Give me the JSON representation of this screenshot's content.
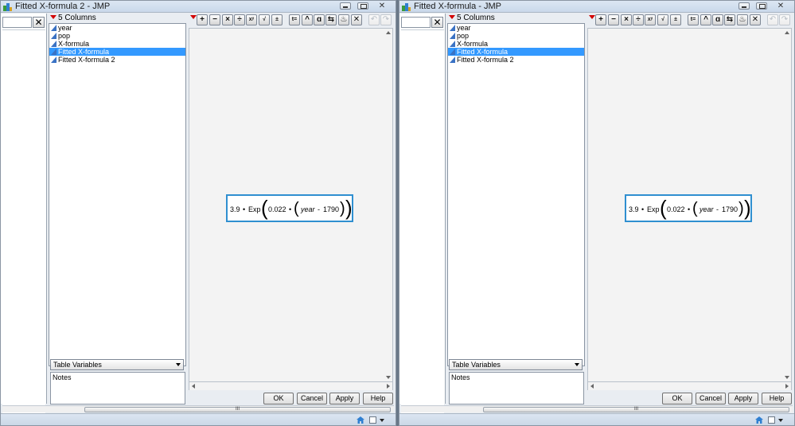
{
  "windows": [
    {
      "title": "Fitted X-formula 2 - JMP",
      "column_count_label": "5 Columns",
      "columns": [
        {
          "label": "year",
          "selected": false
        },
        {
          "label": "pop",
          "selected": false
        },
        {
          "label": "X-formula",
          "selected": false
        },
        {
          "label": "Fitted X-formula",
          "selected": true
        },
        {
          "label": "Fitted X-formula 2",
          "selected": false
        }
      ],
      "table_variables_label": "Table Variables",
      "notes_label": "Notes",
      "formula": {
        "coef": "3.9",
        "dot": "•",
        "func": "Exp",
        "rate": "0.022",
        "var": "year",
        "minus": "-",
        "offset": "1790"
      },
      "buttons": {
        "ok": "OK",
        "cancel": "Cancel",
        "apply": "Apply",
        "help": "Help"
      },
      "scroll_thumb_grip": "III"
    },
    {
      "title": "Fitted X-formula - JMP",
      "column_count_label": "5 Columns",
      "columns": [
        {
          "label": "year",
          "selected": false
        },
        {
          "label": "pop",
          "selected": false
        },
        {
          "label": "X-formula",
          "selected": false
        },
        {
          "label": "Fitted X-formula",
          "selected": true
        },
        {
          "label": "Fitted X-formula 2",
          "selected": false
        }
      ],
      "table_variables_label": "Table Variables",
      "notes_label": "Notes",
      "formula": {
        "coef": "3.9",
        "dot": "•",
        "func": "Exp",
        "rate": "0.022",
        "var": "year",
        "minus": "-",
        "offset": "1790"
      },
      "buttons": {
        "ok": "OK",
        "cancel": "Cancel",
        "apply": "Apply",
        "help": "Help"
      },
      "scroll_thumb_grip": "III"
    }
  ],
  "toolbar_buttons": [
    {
      "name": "add-button",
      "glyph": "+"
    },
    {
      "name": "subtract-button",
      "glyph": "−"
    },
    {
      "name": "multiply-button",
      "glyph": "×"
    },
    {
      "name": "divide-button",
      "glyph": "÷"
    },
    {
      "name": "power-button",
      "glyph": "xʸ"
    },
    {
      "name": "root-button",
      "glyph": "√"
    },
    {
      "name": "change-sign-button",
      "glyph": "±"
    },
    {
      "name": "local-assign-button",
      "glyph": "t="
    },
    {
      "name": "peel-expression-button",
      "glyph": "^"
    },
    {
      "name": "unary-function-button",
      "glyph": "ɑ"
    },
    {
      "name": "swap-button",
      "glyph": "⇆"
    },
    {
      "name": "fire-button",
      "glyph": "♨"
    },
    {
      "name": "delete-button",
      "glyph": "✕"
    }
  ],
  "colors": {
    "selection": "#3399ff",
    "formula_border": "#2f8fd0",
    "menu_triangle": "#d20000",
    "column_icon": "#3a72c4"
  }
}
